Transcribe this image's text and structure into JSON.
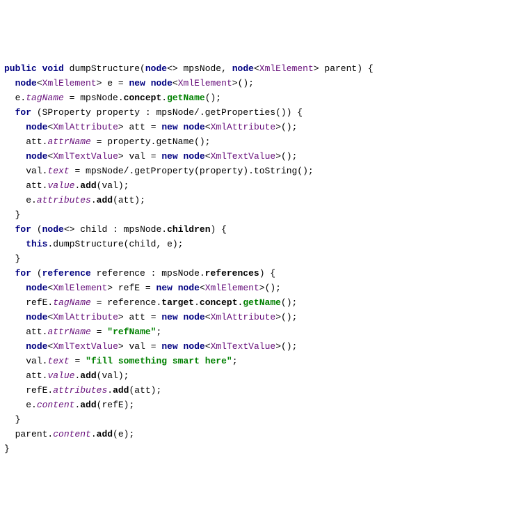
{
  "code": {
    "l1": {
      "t1": "public void",
      "t2": "dumpStructure(",
      "t3": "node",
      "t4": "mpsNode,",
      "t5": "node",
      "t6": "XmlElement",
      "t7": "parent) {",
      "lt": "<>",
      "open": "<",
      "close": ">"
    },
    "l2": {
      "t1": "node",
      "t2": "XmlElement",
      "t3": "e =",
      "t4": "new node",
      "t5": "XmlElement",
      "t6": "();"
    },
    "l3": {
      "t1": "e.",
      "t2": "tagName",
      "t3": " = mpsNode.",
      "t4": "concept",
      "t5": ".",
      "t6": "getName",
      "t7": "();"
    },
    "l4": {
      "t1": "for",
      "t2": " (SProperty property : mpsNode/.getProperties()) {"
    },
    "l5": {
      "t1": "node",
      "t2": "XmlAttribute",
      "t3": "att =",
      "t4": "new node",
      "t5": "XmlAttribute",
      "t6": "();"
    },
    "l6": {
      "t1": "att.",
      "t2": "attrName",
      "t3": " = property.getName();"
    },
    "l7": {
      "t1": "node",
      "t2": "XmlTextValue",
      "t3": "val =",
      "t4": "new node",
      "t5": "XmlTextValue",
      "t6": "();"
    },
    "l8": {
      "t1": "val.",
      "t2": "text",
      "t3": " = mpsNode/.getProperty(property).toString();"
    },
    "l9": {
      "t1": "att.",
      "t2": "value",
      "t3": ".",
      "t4": "add",
      "t5": "(val);"
    },
    "l10": {
      "t1": "e.",
      "t2": "attributes",
      "t3": ".",
      "t4": "add",
      "t5": "(att);"
    },
    "l11": {
      "t1": "}"
    },
    "l12": {
      "t1": "for",
      "t2": " (",
      "t3": "node",
      "t4": "child : mpsNode.",
      "t5": "children",
      "t6": ") {"
    },
    "l13": {
      "t1": "this",
      "t2": ".dumpStructure(child, e);"
    },
    "l14": {
      "t1": "}"
    },
    "l15": {
      "t1": "for",
      "t2": " (",
      "t3": "reference",
      "t4": " reference : mpsNode.",
      "t5": "references",
      "t6": ") {"
    },
    "l16": {
      "t1": "node",
      "t2": "XmlElement",
      "t3": "refE =",
      "t4": "new node",
      "t5": "XmlElement",
      "t6": "();"
    },
    "l17": {
      "t1": "refE.",
      "t2": "tagName",
      "t3": " = reference.",
      "t4": "target",
      "t5": ".",
      "t6": "concept",
      "t7": ".",
      "t8": "getName",
      "t9": "();"
    },
    "l18": {
      "t1": "node",
      "t2": "XmlAttribute",
      "t3": "att =",
      "t4": "new node",
      "t5": "XmlAttribute",
      "t6": "();"
    },
    "l19": {
      "t1": "att.",
      "t2": "attrName",
      "t3": " = ",
      "t4": "\"refName\"",
      "t5": ";"
    },
    "l20": {
      "t1": "node",
      "t2": "XmlTextValue",
      "t3": "val =",
      "t4": "new node",
      "t5": "XmlTextValue",
      "t6": "();"
    },
    "l21": {
      "t1": "val.",
      "t2": "text",
      "t3": " = ",
      "t4": "\"fill something smart here\"",
      "t5": ";"
    },
    "l22": {
      "t1": "att.",
      "t2": "value",
      "t3": ".",
      "t4": "add",
      "t5": "(val);"
    },
    "l23": {
      "t1": "refE.",
      "t2": "attributes",
      "t3": ".",
      "t4": "add",
      "t5": "(att);"
    },
    "l24": {
      "t1": "e.",
      "t2": "content",
      "t3": ".",
      "t4": "add",
      "t5": "(refE);"
    },
    "l25": {
      "t1": "}"
    },
    "l26": {
      "t1": "parent.",
      "t2": "content",
      "t3": ".",
      "t4": "add",
      "t5": "(e);"
    },
    "l27": {
      "t1": "}"
    }
  }
}
